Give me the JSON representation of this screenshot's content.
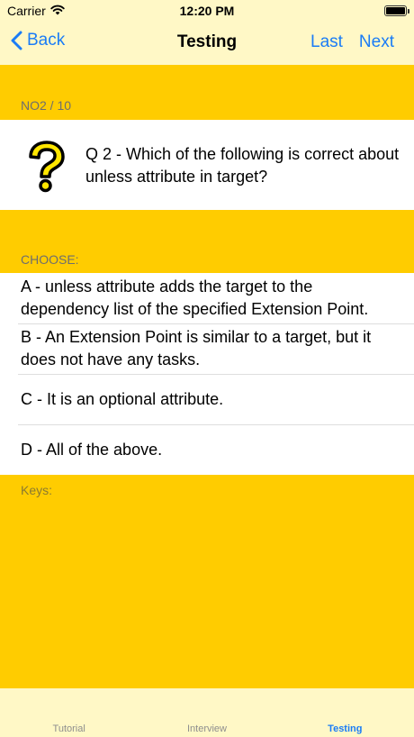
{
  "status_bar": {
    "carrier": "Carrier",
    "time": "12:20 PM"
  },
  "nav": {
    "back_label": "Back",
    "title": "Testing",
    "last_label": "Last",
    "next_label": "Next"
  },
  "progress": {
    "label": "NO2 / 10"
  },
  "question": {
    "text": "Q 2 - Which of the following is correct about unless attribute in target?"
  },
  "choose": {
    "label": "CHOOSE:",
    "options": [
      "A - unless attribute adds the target to the dependency list of the specified Extension Point.",
      "B - An Extension Point is similar to a target, but it does not have any tasks.",
      "C - It is an optional attribute.",
      "D - All of the above."
    ]
  },
  "keys": {
    "label": "Keys:"
  },
  "tabbar": {
    "tabs": [
      "Tutorial",
      "Interview",
      "Testing"
    ],
    "active": "Testing"
  },
  "colors": {
    "background": "#ffcc00",
    "bar": "#fff8c6",
    "accent": "#1a7cf6"
  }
}
